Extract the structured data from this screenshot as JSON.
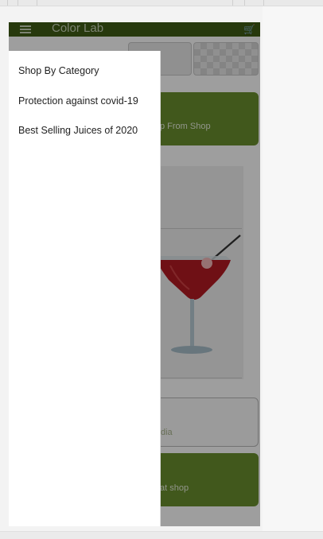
{
  "app": {
    "title": "Color Lab"
  },
  "icons": {
    "menu": "menu-icon",
    "cart": "cart-icon"
  },
  "drawer": {
    "items": [
      {
        "label": "Shop By Category"
      },
      {
        "label": "Protection against covid-19"
      },
      {
        "label": "Best Selling Juices of 2020"
      }
    ]
  },
  "background": {
    "card_1_partial_text": "p From Shop",
    "card_2_partial_text": "dia",
    "card_3_partial_text": "at shop"
  },
  "colors": {
    "app_bar": "#3f5c16",
    "accent_green": "#6a8f2e",
    "scrim": "rgba(0,0,0,0.38)",
    "drawer_bg": "#ffffff"
  }
}
